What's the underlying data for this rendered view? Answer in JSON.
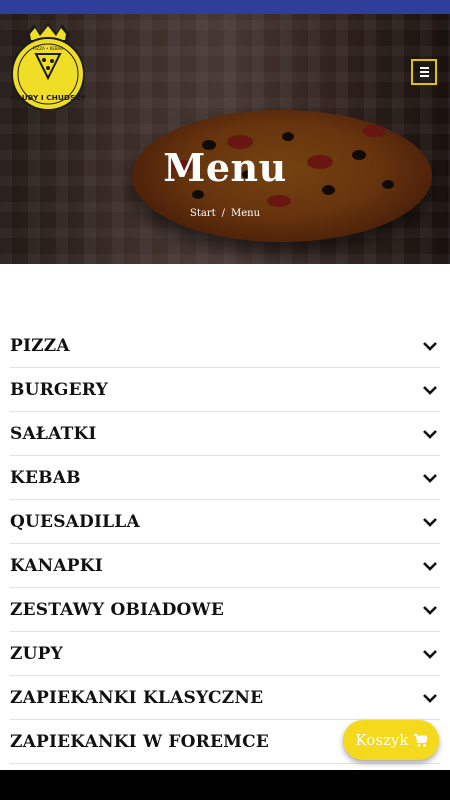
{
  "colors": {
    "top_strip": "#2f3d9b",
    "accent_yellow": "#f5d91c",
    "logo_yellow": "#f0dd26",
    "menu_toggle_border": "#e4c400",
    "text_dark": "#111111",
    "bottom_bar": "#000000"
  },
  "header": {
    "logo": {
      "text": "GRUBY I CHUDSZY",
      "subtext": "PIZZA • KEBAB",
      "icon": "crown-pizza-logo"
    },
    "menu_toggle_icon": "hamburger-icon"
  },
  "hero": {
    "title": "Menu",
    "breadcrumb": {
      "home": "Start",
      "separator": "/",
      "current": "Menu"
    },
    "background": "pizza-photo"
  },
  "menu": {
    "categories": [
      {
        "label": "PIZZA"
      },
      {
        "label": "BURGERY"
      },
      {
        "label": "SAŁATKI"
      },
      {
        "label": "KEBAB"
      },
      {
        "label": "QUESADILLA"
      },
      {
        "label": "KANAPKI"
      },
      {
        "label": "ZESTAWY OBIADOWE"
      },
      {
        "label": "ZUPY"
      },
      {
        "label": "ZAPIEKANKI KLASYCZNE"
      },
      {
        "label": "ZAPIEKANKI W FOREMCE"
      }
    ],
    "expand_icon": "chevron-down-icon"
  },
  "cart": {
    "label": "Koszyk",
    "icon": "cart-icon"
  }
}
